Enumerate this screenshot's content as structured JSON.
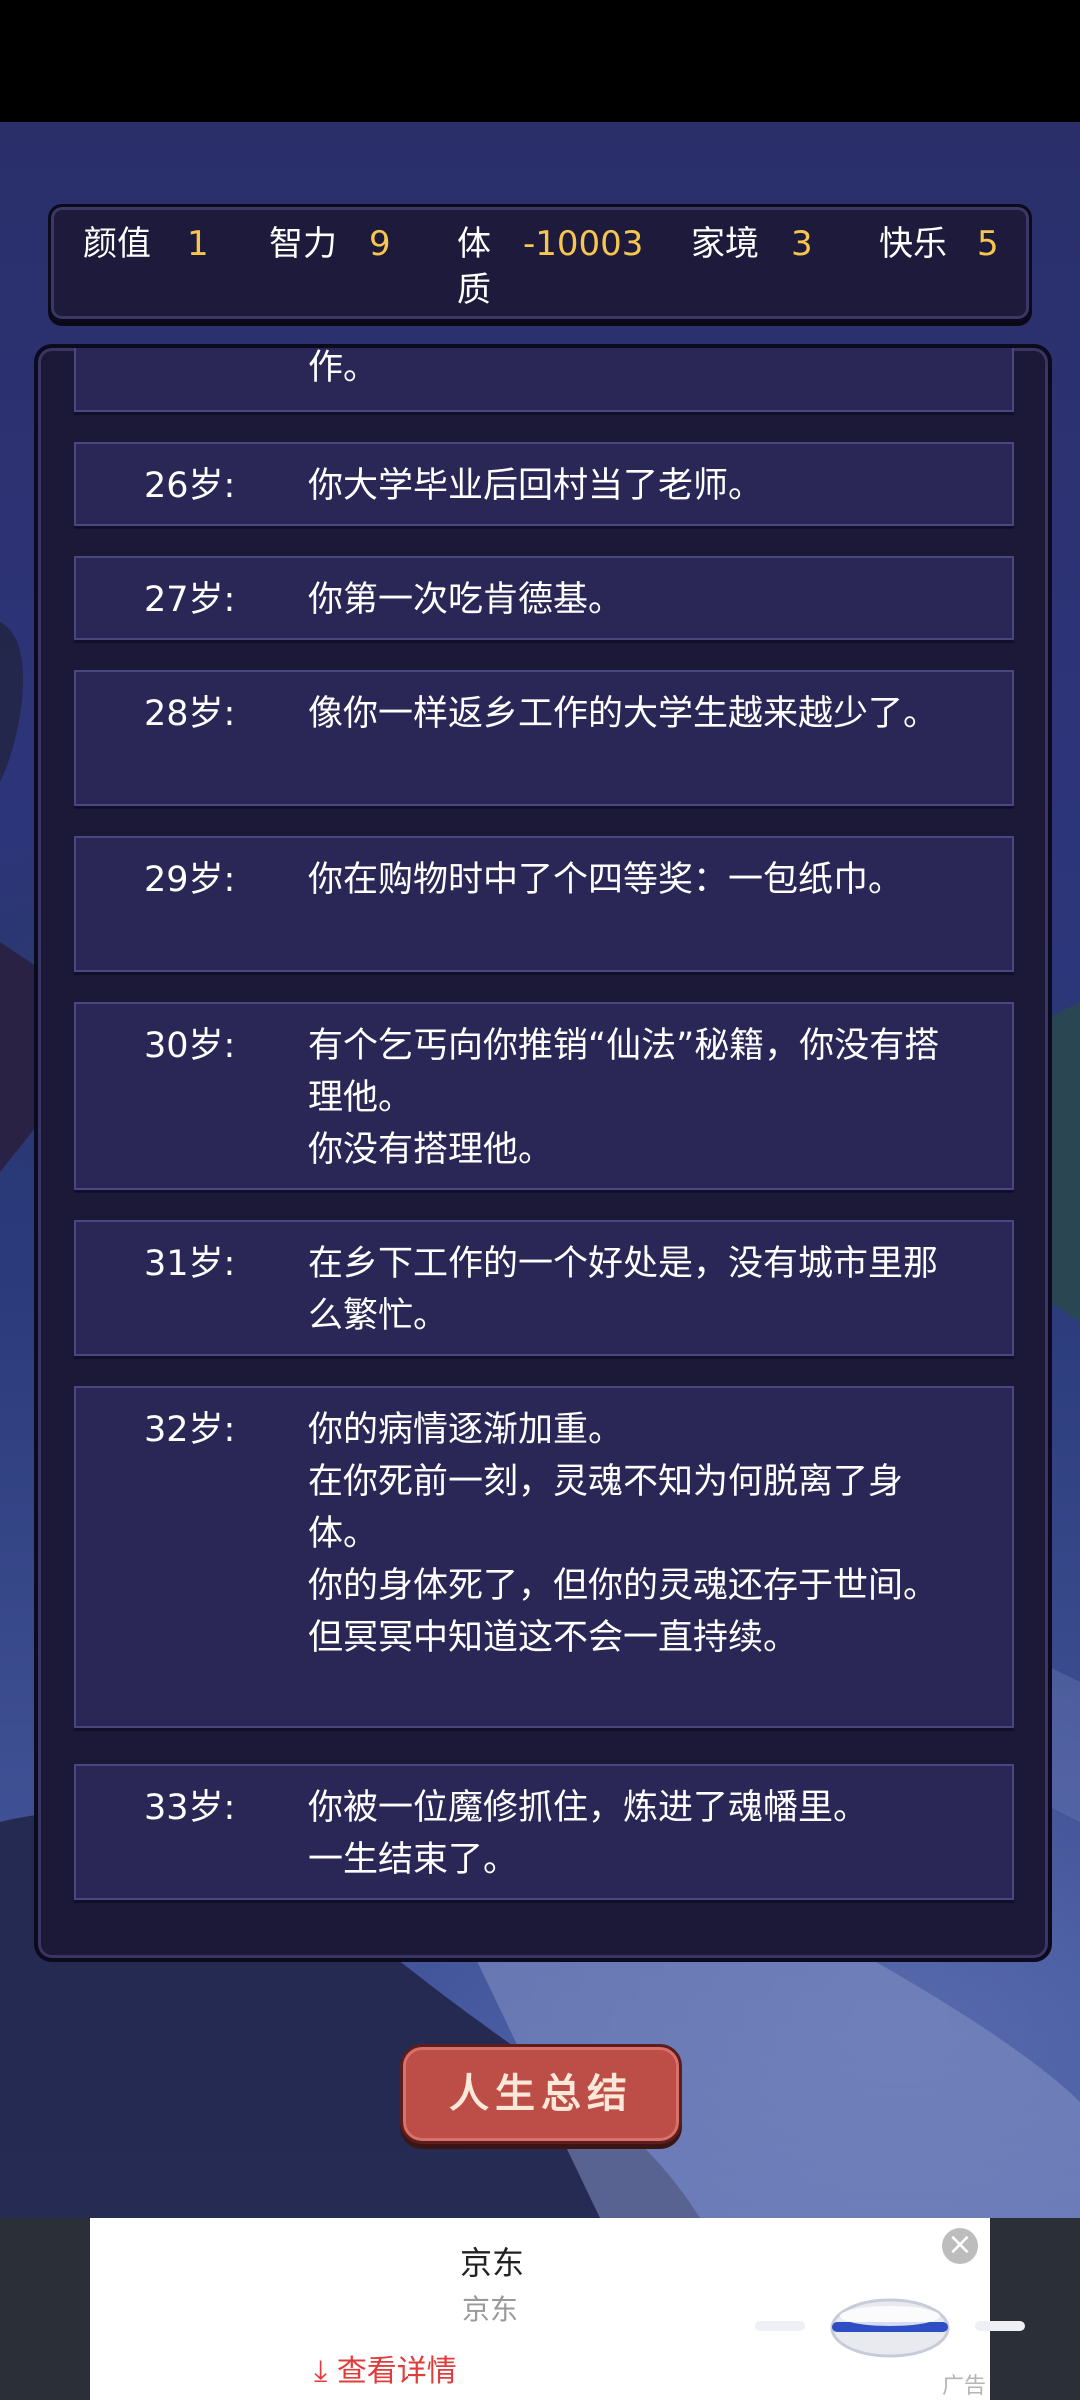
{
  "stats": [
    {
      "label": "颜值",
      "value": "1"
    },
    {
      "label": "智力",
      "value": "9"
    },
    {
      "label": "体质",
      "value": "-10003"
    },
    {
      "label": "家境",
      "value": "3"
    },
    {
      "label": "快乐",
      "value": "5"
    }
  ],
  "events": [
    {
      "age": "",
      "lines": [
        "作。"
      ]
    },
    {
      "age": "26岁:",
      "lines": [
        "你大学毕业后回村当了老师。"
      ]
    },
    {
      "age": "27岁:",
      "lines": [
        "你第一次吃肯德基。"
      ]
    },
    {
      "age": "28岁:",
      "lines": [
        "像你一样返乡工作的大学生越来越少了。"
      ]
    },
    {
      "age": "29岁:",
      "lines": [
        "你在购物时中了个四等奖：一包纸巾。"
      ]
    },
    {
      "age": "30岁:",
      "lines": [
        "有个乞丐向你推销“仙法”秘籍，你没有搭理他。",
        "你没有搭理他。"
      ]
    },
    {
      "age": "31岁:",
      "lines": [
        "在乡下工作的一个好处是，没有城市里那么繁忙。"
      ]
    },
    {
      "age": "32岁:",
      "lines": [
        "你的病情逐渐加重。",
        "在你死前一刻，灵魂不知为何脱离了身体。",
        "你的身体死了，但你的灵魂还存于世间。",
        "但冥冥中知道这不会一直持续。"
      ]
    },
    {
      "age": "33岁:",
      "lines": [
        "你被一位魔修抓住，炼进了魂幡里。",
        "一生结束了。"
      ]
    }
  ],
  "summary_button": "人生总结",
  "ad": {
    "title": "京东",
    "subtitle": "京东",
    "link": "查看详情",
    "tag": "广告",
    "close_icon": "close-icon",
    "link_icon": "download-arrow-icon"
  }
}
